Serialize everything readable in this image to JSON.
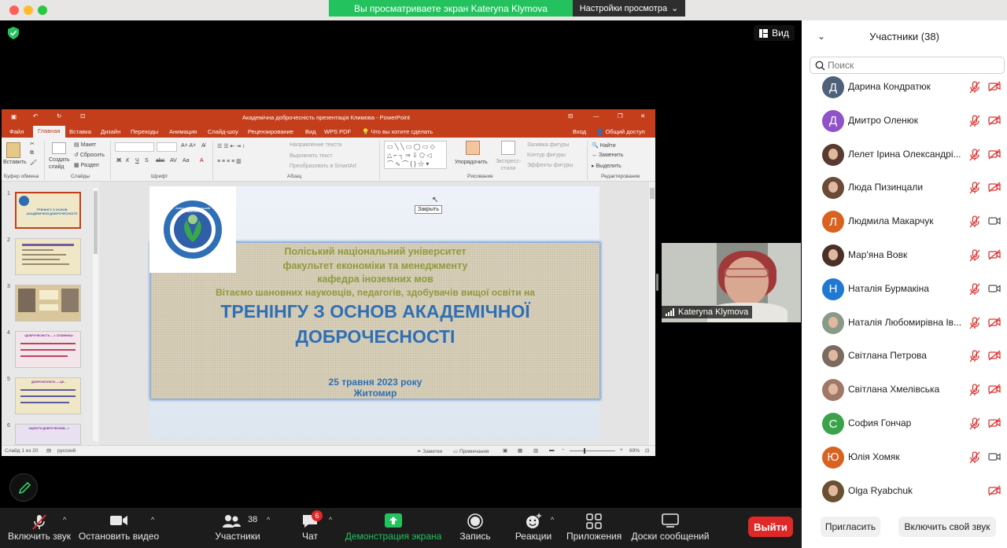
{
  "banner": {
    "text": "Вы просматриваете экран Kateryna Klymova",
    "settings": "Настройки просмотра"
  },
  "view_button": "Вид",
  "ppt": {
    "title": "Академічна доброчесність презентація Климова - PowerPoint",
    "tabs": [
      "Файл",
      "Главная",
      "Вставка",
      "Дизайн",
      "Переходы",
      "Анимация",
      "Слайд-шоу",
      "Рецензирование",
      "Вид",
      "WPS PDF",
      "Что вы хотите сделать"
    ],
    "login": "Вход",
    "share": "Общий доступ",
    "ribbon": {
      "paste": "Вставить",
      "create_slide": "Создать слайд",
      "layout": "Макет",
      "reset": "Сбросить",
      "section": "Раздел",
      "bold": "Ж",
      "italic": "К",
      "underline": "Ч",
      "strike": "S",
      "spacing": "abc",
      "case": "Aa",
      "text_direction": "Направление текста",
      "align_text": "Выровнять текст",
      "smartart": "Преобразовать в SmartArt",
      "arrange": "Упорядочить",
      "quick_styles": "Экспресс-стили",
      "shape_fill": "Заливка фигуры",
      "shape_outline": "Контур фигуры",
      "shape_effects": "Эффекты фигуры",
      "find": "Найти",
      "replace": "Заменить",
      "select": "Выделить"
    },
    "groups": [
      "Буфер обмена",
      "Слайды",
      "Шрифт",
      "Абзац",
      "Рисование",
      "Редактирование"
    ],
    "thumb_numbers": [
      "1",
      "2",
      "3",
      "4",
      "5",
      "6"
    ],
    "thumb1_title": "ТРЕНІНГУ З ОСНОВ АКАДЕМІЧНОЇ ДОБРОЧЕСНОСТІ",
    "thumb4_title": "«ДОБРОЧЕСНІСТЬ — 1 СЛОВНИКА»",
    "thumb5_title": "ДОБРОЧЕСНІСТЬ — ЦЕ...",
    "thumb6_title": "«ЩОБУТИ ДОБРОЧЕСНИМ…»",
    "tooltip": "Закрыть",
    "slide": {
      "logo_text": "ПОЛІСЬКИЙ НАЦІОНАЛЬНИЙ УНІВЕРСИТЕТ",
      "line1": "Поліський національний університет",
      "line2": "факультет економіки та менеджменту",
      "line3": "кафедра іноземних мов",
      "line4": "Вітаємо шановних науковців, педагогів, здобувачів вищої освіти на",
      "title1": "ТРЕНІНГУ З ОСНОВ АКАДЕМІЧНОЇ",
      "title2": "ДОБРОЧЕСНОСТІ",
      "date": "25 травня 2023 року",
      "city": "Житомир"
    },
    "status": {
      "slide_of": "Слайд 1 из 20",
      "lang": "русский",
      "notes": "Заметки",
      "comments": "Примечания",
      "zoom": "69%"
    }
  },
  "video": {
    "name": "Kateryna Klymova"
  },
  "toolbar": {
    "mute": "Включить звук",
    "video": "Остановить видео",
    "participants": "Участники",
    "participants_count": "38",
    "chat": "Чат",
    "chat_badge": "6",
    "share": "Демонстрация экрана",
    "record": "Запись",
    "reactions": "Реакции",
    "apps": "Приложения",
    "whiteboards": "Доски сообщений",
    "leave": "Выйти"
  },
  "panel": {
    "title": "Участники (38)",
    "search_placeholder": "Поиск",
    "invite": "Пригласить",
    "unmute_me": "Включить свой звук"
  },
  "participants": [
    {
      "initial": "Д",
      "name": "Дарина Кондратюк",
      "color": "#4e6178",
      "photo": false,
      "cam": false
    },
    {
      "initial": "Д",
      "name": "Дмитро Оленюк",
      "color": "#8e52c9",
      "photo": false,
      "cam": false
    },
    {
      "initial": "",
      "name": "Лелет Ірина Олександрі...",
      "color": "#5a3a30",
      "photo": true,
      "cam": false
    },
    {
      "initial": "",
      "name": "Люда Пизинцали",
      "color": "#6b4a38",
      "photo": true,
      "cam": false
    },
    {
      "initial": "Л",
      "name": "Людмила Макарчук",
      "color": "#d96221",
      "photo": false,
      "cam": true
    },
    {
      "initial": "",
      "name": "Мар'яна Вовк",
      "color": "#4a3028",
      "photo": true,
      "cam": false
    },
    {
      "initial": "Н",
      "name": "Наталія Бурмакіна",
      "color": "#1f78d1",
      "photo": false,
      "cam": true
    },
    {
      "initial": "",
      "name": "Наталія Любомирівна Ів...",
      "color": "#8a9a88",
      "photo": true,
      "cam": false
    },
    {
      "initial": "",
      "name": "Світлана Петрова",
      "color": "#7a6a60",
      "photo": true,
      "cam": false
    },
    {
      "initial": "",
      "name": "Світлана Хмелівська",
      "color": "#a07868",
      "photo": true,
      "cam": false
    },
    {
      "initial": "С",
      "name": "София Гончар",
      "color": "#3ba24a",
      "photo": false,
      "cam": false
    },
    {
      "initial": "Ю",
      "name": "Юлія Хомяк",
      "color": "#d96221",
      "photo": false,
      "cam": true
    },
    {
      "initial": "",
      "name": "Olga Ryabchuk",
      "color": "#6a5030",
      "photo": true,
      "cam": false
    }
  ],
  "colors": {
    "accent_green": "#23c25e",
    "ppt_red": "#c43e1c",
    "leave_red": "#e02828",
    "muted_red": "#e0322f",
    "slide_blue": "#2e6fb5"
  }
}
